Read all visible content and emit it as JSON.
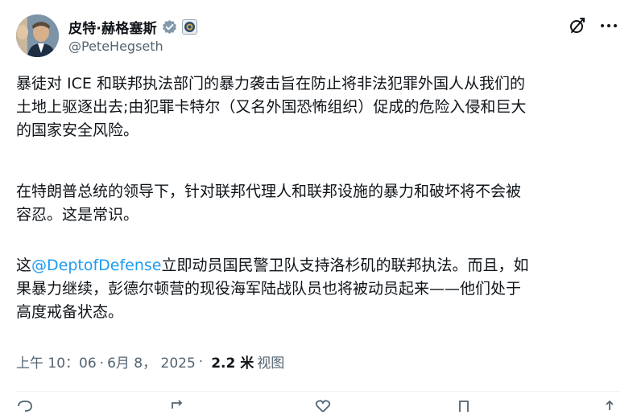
{
  "author": {
    "display_name": "皮特·赫格塞斯",
    "handle": "@PeteHegseth"
  },
  "icons": {
    "avatar": "avatar",
    "verified": "verified-badge-icon",
    "affiliation": "affiliation-badge-icon",
    "grok": "grok-icon",
    "more": "more-options-icon",
    "reply": "reply-icon",
    "repost": "repost-icon",
    "like": "like-icon",
    "bookmark": "bookmark-icon",
    "share": "share-icon"
  },
  "colors": {
    "text": "#0f1419",
    "secondary": "#536471",
    "link": "#1d9bf0",
    "verified": "#829aab"
  },
  "post": {
    "p1_line1": "暴徒对 ICE 和联邦执法部门的暴力袭击旨在防止将非法犯罪外国人从我们的",
    "p1_line2": "土地上驱逐出去;由犯罪卡特尔（又名外国恐怖组织）促成的危险入侵和巨大",
    "p1_line3": "的国家安全风险。",
    "p2_line1": "在特朗普总统的领导下，针对联邦代理人和联邦设施的暴力和破坏将不会被",
    "p2_line2": "容忍。这是常识。",
    "p3_prefix": "这",
    "p3_mention": "@DeptofDefense",
    "p3_line1_rest": "立即动员国民警卫队支持洛杉矶的联邦执法。而且，如",
    "p3_line2": "果暴力继续，彭德尔顿营的现役海军陆战队员也将被动员起来——他们处于",
    "p3_line3": "高度戒备状态。"
  },
  "meta": {
    "time": "上午 10：06",
    "date": "6月 8， 2025",
    "views_count": "2.2 米",
    "views_label": "视图"
  }
}
